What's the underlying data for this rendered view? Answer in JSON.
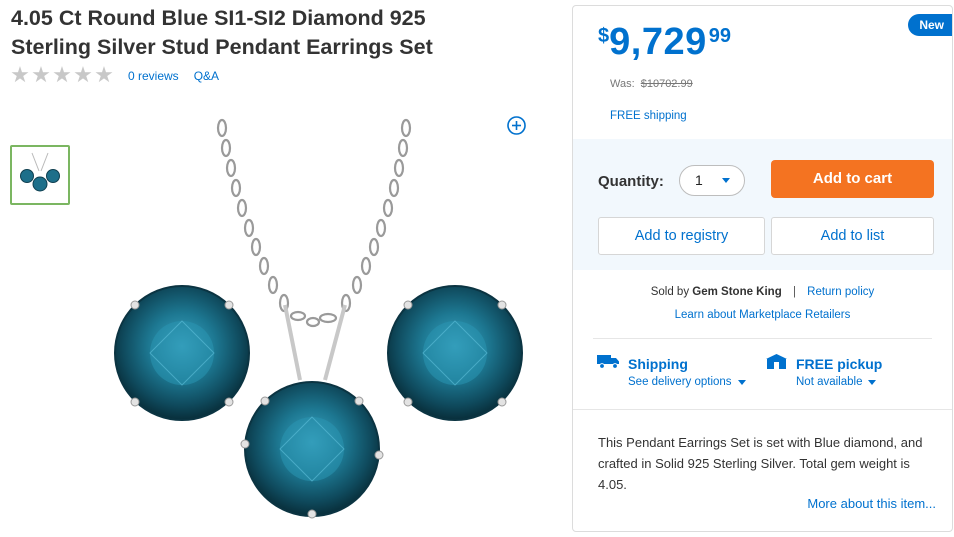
{
  "product": {
    "title": "4.05 Ct Round Blue SI1-SI2 Diamond 925 Sterling Silver Stud Pendant Earrings Set",
    "rating_stars": 0,
    "reviews_label": "0 reviews",
    "qa_label": "Q&A"
  },
  "offer": {
    "badge": "New",
    "price_currency": "$",
    "price_main": "9,729",
    "price_cents": "99",
    "was_label": "Was:",
    "was_price": "$10702.99",
    "shipping_note": "FREE shipping",
    "quantity_label": "Quantity:",
    "quantity_value": "1",
    "add_to_cart": "Add to cart",
    "add_to_registry": "Add to registry",
    "add_to_list": "Add to list"
  },
  "seller": {
    "sold_by_prefix": "Sold by",
    "seller_name": "Gem Stone King",
    "separator": "|",
    "return_policy": "Return policy",
    "learn_more": "Learn about Marketplace Retailers"
  },
  "fulfillment": {
    "shipping_label": "Shipping",
    "shipping_sub": "See delivery options",
    "pickup_label": "FREE pickup",
    "pickup_sub": "Not available"
  },
  "description": {
    "text": "This Pendant Earrings Set is set with Blue diamond, and crafted in Solid 925 Sterling Silver. Total gem weight is 4.05.",
    "more_link": "More about this item..."
  },
  "colors": {
    "brand_blue": "#0071ce",
    "cart_orange": "#f47321",
    "thumb_green": "#7bb661",
    "gem_blue": "#1d6f8a"
  },
  "icons": {
    "zoom": "zoom-in-icon",
    "shipping": "truck-icon",
    "pickup": "store-icon",
    "star": "star-icon"
  }
}
